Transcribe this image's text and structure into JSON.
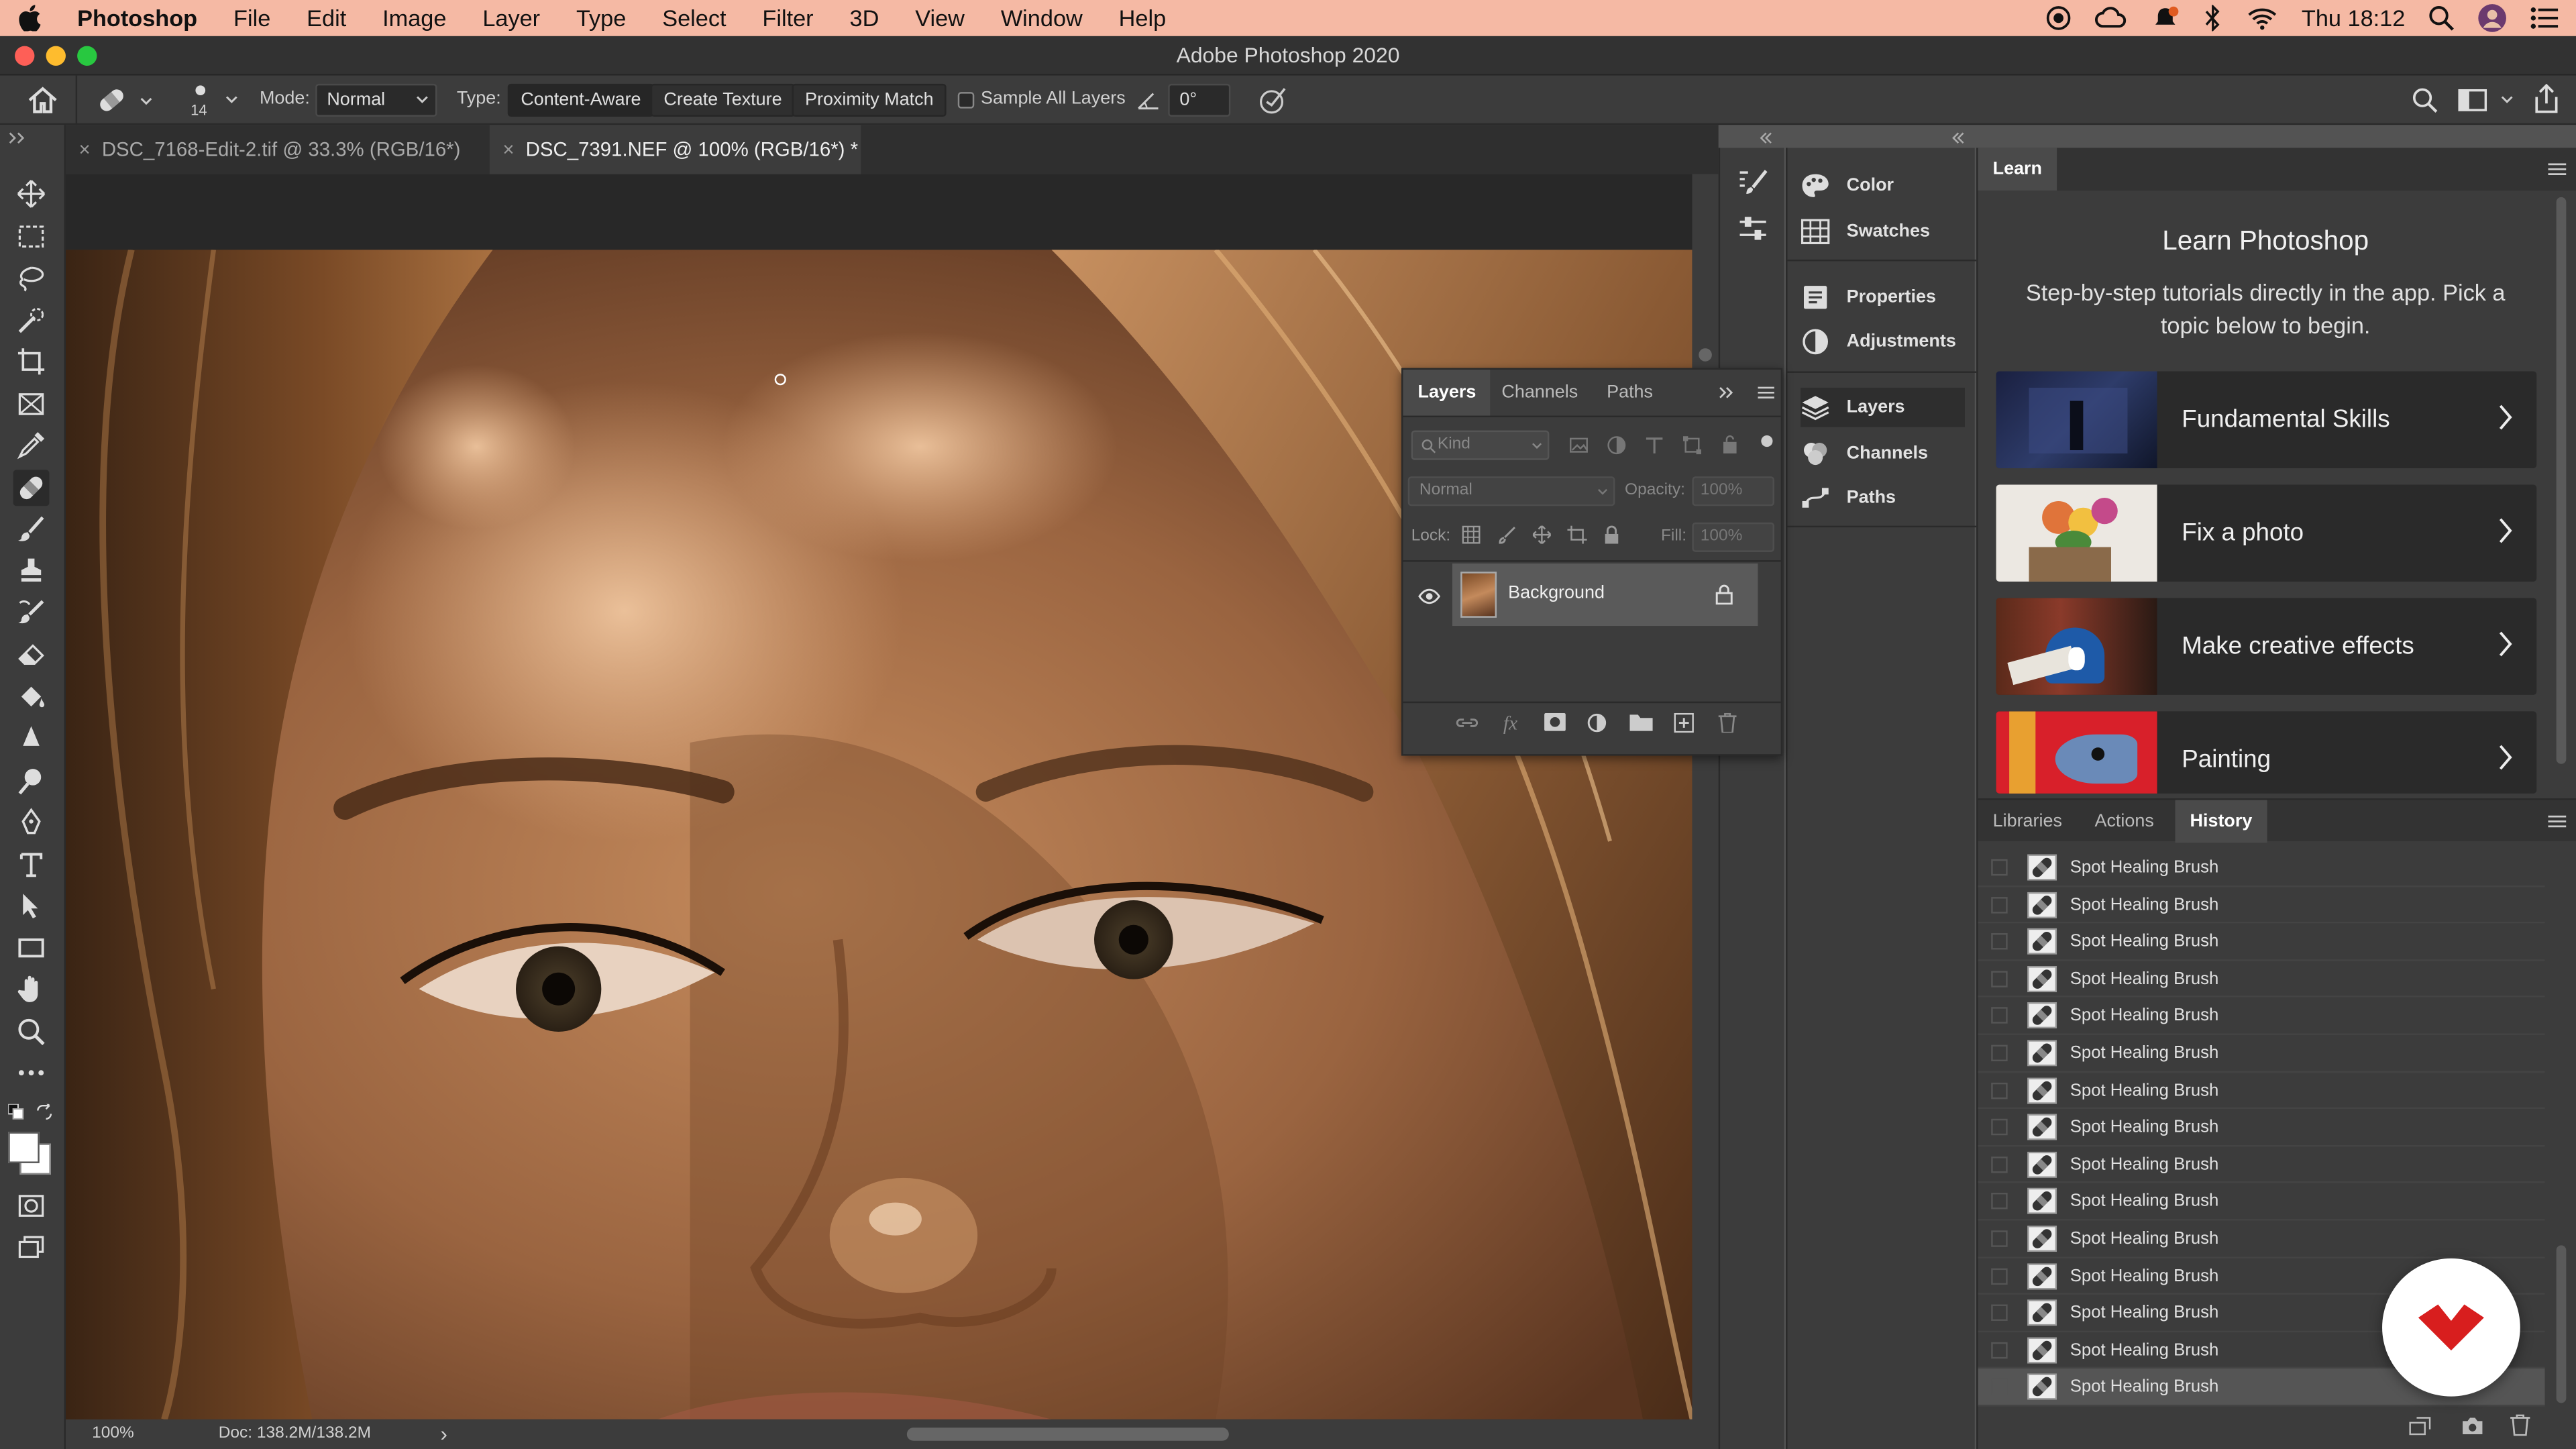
{
  "menubar": {
    "apple": "",
    "items": [
      "Photoshop",
      "File",
      "Edit",
      "Image",
      "Layer",
      "Type",
      "Select",
      "Filter",
      "3D",
      "View",
      "Window",
      "Help"
    ],
    "clock": "Thu 18:12",
    "bg_color": "#f5b9a4"
  },
  "window": {
    "title": "Adobe Photoshop 2020"
  },
  "options": {
    "brush_size": "14",
    "mode_label": "Mode:",
    "mode_value": "Normal",
    "type_label": "Type:",
    "type_buttons": [
      "Content-Aware",
      "Create Texture",
      "Proximity Match"
    ],
    "sample_all_layers": "Sample All Layers",
    "angle_value": "0°"
  },
  "tabs": [
    {
      "label": "DSC_7168-Edit-2.tif @ 33.3% (RGB/16*)",
      "close": "×"
    },
    {
      "label": "DSC_7391.NEF @ 100% (RGB/16*) *",
      "close": "×"
    }
  ],
  "status": {
    "zoom": "100%",
    "doc": "Doc: 138.2M/138.2M",
    "arrow": "›"
  },
  "mid_panel": {
    "items": [
      "Color",
      "Swatches",
      "Properties",
      "Adjustments",
      "Layers",
      "Channels",
      "Paths"
    ]
  },
  "layers_panel": {
    "tabs": [
      "Layers",
      "Channels",
      "Paths"
    ],
    "kind_placeholder": "Kind",
    "blend_mode": "Normal",
    "opacity_label": "Opacity:",
    "opacity_value": "100%",
    "lock_label": "Lock:",
    "fill_label": "Fill:",
    "fill_value": "100%",
    "layer_name": "Background"
  },
  "learn": {
    "tab": "Learn",
    "heading": "Learn Photoshop",
    "description": "Step-by-step tutorials directly in the app. Pick a topic below to begin.",
    "cards": [
      "Fundamental Skills",
      "Fix a photo",
      "Make creative effects",
      "Painting"
    ]
  },
  "bottom_tabs": [
    "Libraries",
    "Actions",
    "History"
  ],
  "history": {
    "items": [
      "Spot Healing Brush",
      "Spot Healing Brush",
      "Spot Healing Brush",
      "Spot Healing Brush",
      "Spot Healing Brush",
      "Spot Healing Brush",
      "Spot Healing Brush",
      "Spot Healing Brush",
      "Spot Healing Brush",
      "Spot Healing Brush",
      "Spot Healing Brush",
      "Spot Healing Brush",
      "Spot Healing Brush",
      "Spot Healing Brush",
      "Spot Healing Brush"
    ]
  },
  "icons": [
    "home-icon",
    "healing-brush-icon",
    "move-icon",
    "marquee-icon",
    "lasso-icon",
    "quick-select-icon",
    "crop-icon",
    "frame-icon",
    "eyedropper-icon",
    "brush-icon",
    "stamp-icon",
    "history-brush-icon",
    "eraser-icon",
    "bucket-icon",
    "blur-icon",
    "dodge-icon",
    "pen-icon",
    "type-icon",
    "path-select-icon",
    "rectangle-icon",
    "hand-icon",
    "zoom-icon",
    "more-icon",
    "search-icon",
    "share-icon",
    "eye-icon",
    "lock-icon",
    "trash-icon",
    "camera-icon"
  ],
  "accent": "#d81e1e"
}
